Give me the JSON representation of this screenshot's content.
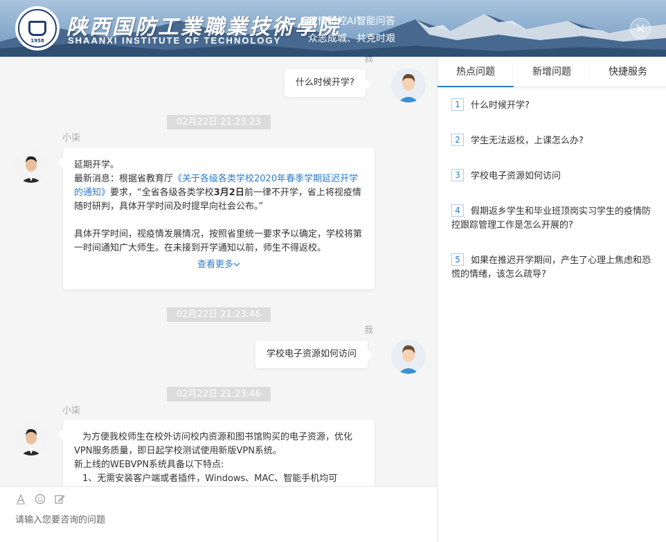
{
  "header": {
    "school_name_cn": "陕西国防工業職業技術學院",
    "school_name_en": "SHAANXI INSTITUTE OF TECHNOLOGY",
    "logo_year": "1958",
    "title": "疫情防控AI智能问答",
    "subtitle": "众志成城、共克时艰"
  },
  "chat": {
    "messages": [
      {
        "sender": "我",
        "text": "什么时候开学?"
      },
      {
        "timestamp": "02月22日 21:23:23"
      },
      {
        "sender": "小柒",
        "line1": "延期开学。",
        "line2_prefix": "最新消息：根据省教育厅",
        "line2_link": "《关于各级各类学校2020年春季学期延迟开学的通知》",
        "line2_mid": "要求，“全省各级各类学校",
        "line2_bold": "3月2日",
        "line2_suffix": "前一律不开学，省上将视疫情随时研判，具体开学时间及时提早向社会公布。”",
        "para2": "具体开学时间，视疫情发展情况，按照省里统一要求予以确定，学校将第一时间通知广大师生。在未接到开学通知以前，师生不得返校。",
        "more": "查看更多"
      },
      {
        "timestamp": "02月22日 21:23:46"
      },
      {
        "sender": "我",
        "text": "学校电子资源如何访问"
      },
      {
        "timestamp": "02月22日 21:23:46"
      },
      {
        "sender": "小柒",
        "line1": "为方便我校师生在校外访问校内资源和图书馆购买的电子资源，优化VPN服务质量，即日起学校测试使用新版VPN系统。",
        "line2": "新上线的WEBVPN系统具备以下特点:",
        "line3": "1、无需安装客户端或者插件，Windows、MAC、智能手机均可"
      }
    ]
  },
  "input": {
    "placeholder": "请输入您要咨询的问题",
    "tools": [
      "font-icon",
      "emoji-icon",
      "edit-icon"
    ]
  },
  "panel": {
    "tabs": [
      "热点问题",
      "新增问题",
      "快捷服务"
    ],
    "active_tab": "热点问题",
    "questions": [
      {
        "num": "1",
        "text": "什么时候开学?"
      },
      {
        "num": "2",
        "text": "学生无法返校，上课怎么办?"
      },
      {
        "num": "3",
        "text": "学校电子资源如何访问"
      },
      {
        "num": "4",
        "text": "假期返乡学生和毕业班顶岗实习学生的疫情防控跟踪管理工作是怎么开展的?"
      },
      {
        "num": "5",
        "text": "如果在推迟开学期间，产生了心理上焦虑和恐慌的情绪，该怎么疏导?"
      }
    ]
  },
  "colors": {
    "accent": "#2a7ccf",
    "timestamp_bg": "#dcdcdc",
    "chat_bg": "#f5f5f5"
  }
}
